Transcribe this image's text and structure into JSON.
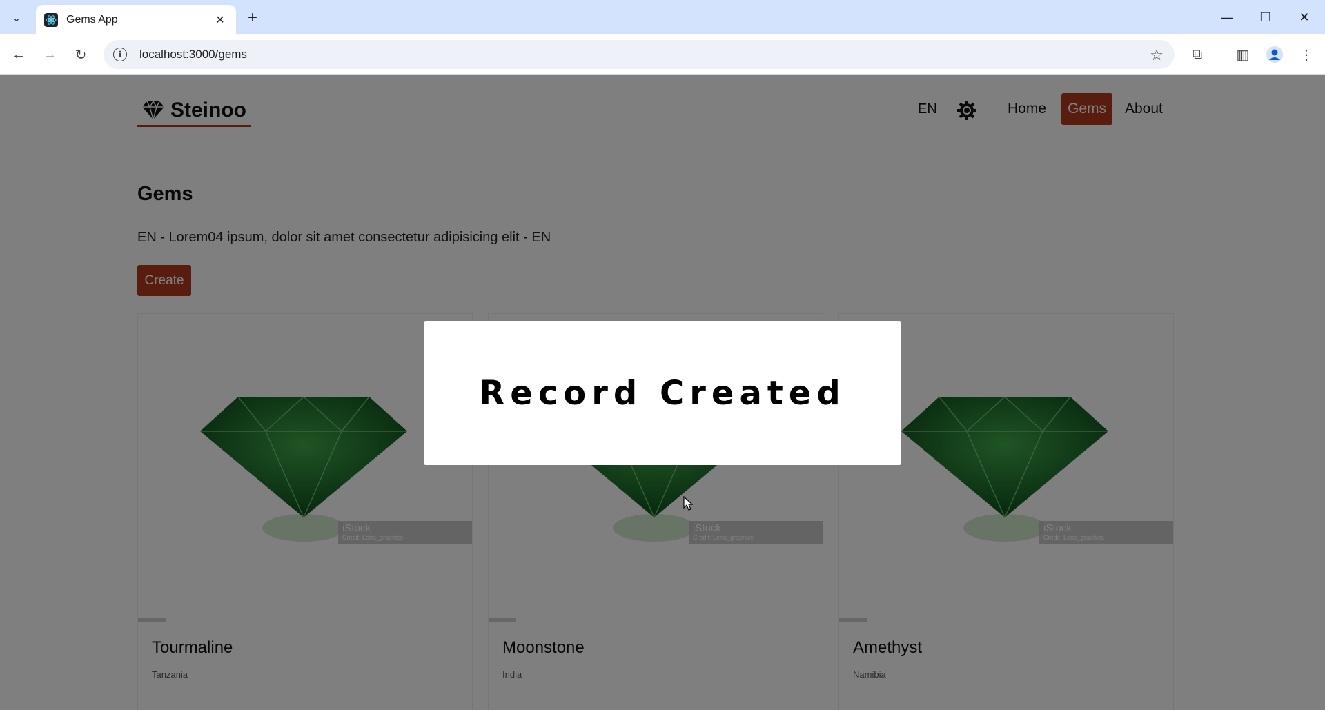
{
  "browser": {
    "tab_title": "Gems App",
    "url": "localhost:3000/gems"
  },
  "app": {
    "brand": "Steinoo",
    "language": "EN",
    "nav": {
      "home": "Home",
      "gems": "Gems",
      "about": "About"
    },
    "accent_color": "#b23a1f"
  },
  "page": {
    "title": "Gems",
    "description": "EN - Lorem04 ipsum, dolor sit amet consectetur adipisicing elit - EN",
    "create_label": "Create"
  },
  "cards": [
    {
      "name": "Tourmaline",
      "origin": "Tanzania",
      "watermark": "iStock",
      "credit": "Credit: Lena_graphics"
    },
    {
      "name": "Moonstone",
      "origin": "India",
      "watermark": "iStock",
      "credit": "Credit: Lena_graphics"
    },
    {
      "name": "Amethyst",
      "origin": "Namibia",
      "watermark": "iStock",
      "credit": "Credit: Lena_graphics"
    }
  ],
  "modal": {
    "message": "Record Created"
  }
}
